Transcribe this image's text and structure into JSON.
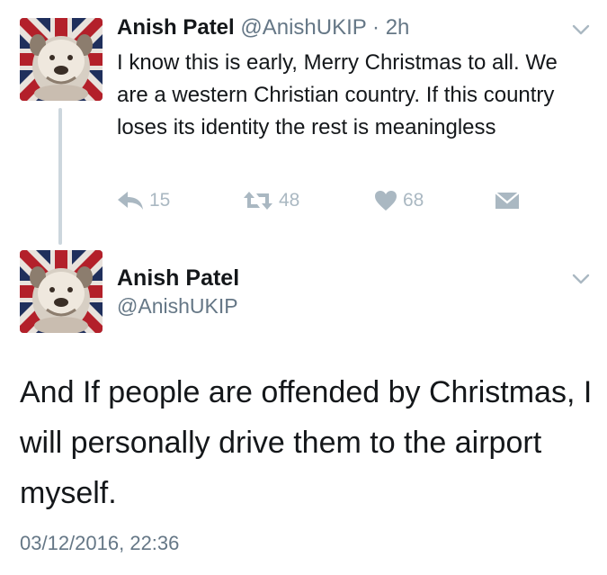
{
  "tweet1": {
    "author_name": "Anish Patel",
    "author_handle": "@AnishUKIP",
    "separator": "·",
    "time_ago": "2h",
    "text": "I know this is early, Merry Christmas to all. We are a western Christian country. If this country loses its identity the rest is meaningless",
    "reply_count": "15",
    "retweet_count": "48",
    "like_count": "68",
    "icons": {
      "avatar": "bulldog-union-jack-avatar",
      "menu": "chevron-down-icon",
      "reply": "reply-icon",
      "retweet": "retweet-icon",
      "like": "heart-icon",
      "dm": "envelope-icon"
    }
  },
  "tweet2": {
    "author_name": "Anish Patel",
    "author_handle": "@AnishUKIP",
    "text": "And If people are offended by Christmas, I will personally drive them to the airport myself.",
    "timestamp": "03/12/2016, 22:36"
  },
  "colors": {
    "text": "#14171a",
    "secondary": "#657786",
    "action_icon": "#aab8c2",
    "thread_line": "#ccd6dd"
  }
}
